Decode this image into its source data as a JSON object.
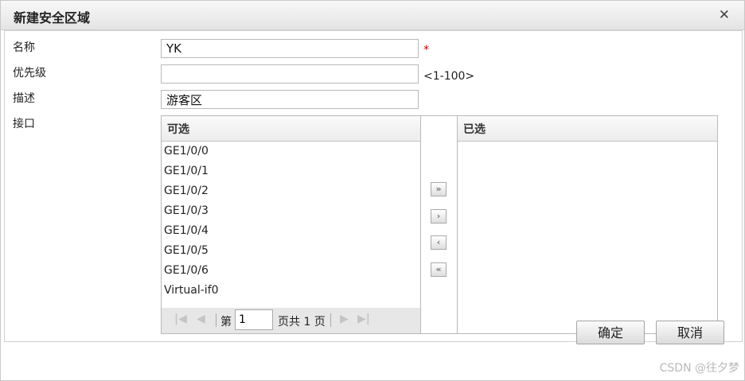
{
  "dialog": {
    "title": "新建安全区域",
    "close_icon": "close-icon"
  },
  "form": {
    "name_label": "名称",
    "name_value": "YK",
    "required_mark": "*",
    "priority_label": "优先级",
    "priority_value": "",
    "priority_hint": "<1-100>",
    "desc_label": "描述",
    "desc_value": "游客区",
    "interface_label": "接口"
  },
  "available": {
    "header": "可选",
    "items": [
      "GE1/0/0",
      "GE1/0/1",
      "GE1/0/2",
      "GE1/0/3",
      "GE1/0/4",
      "GE1/0/5",
      "GE1/0/6",
      "Virtual-if0"
    ]
  },
  "selected": {
    "header": "已选",
    "items": []
  },
  "pager": {
    "page_prefix": "第",
    "page_value": "1",
    "page_suffix": "页共 1 页",
    "icons": [
      "first-page-icon",
      "prev-page-icon",
      "next-page-icon",
      "last-page-icon"
    ]
  },
  "move_buttons": {
    "add_all": "»",
    "add": "›",
    "remove": "‹",
    "remove_all": "«"
  },
  "footer": {
    "ok_label": "确定",
    "cancel_label": "取消"
  },
  "watermark": "CSDN @往夕梦"
}
